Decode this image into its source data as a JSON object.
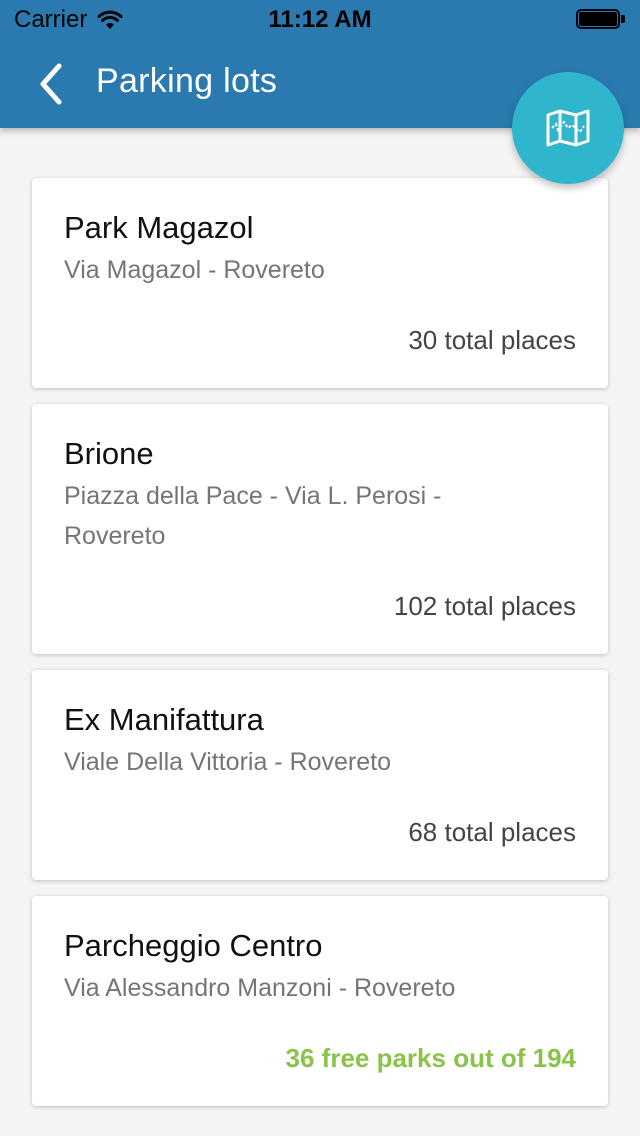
{
  "status_bar": {
    "carrier": "Carrier",
    "time": "11:12 AM"
  },
  "header": {
    "title": "Parking lots",
    "back_icon": "chevron-left-icon",
    "map_icon": "map-icon",
    "background_color": "#2a7ab0",
    "fab_color": "#2fb5cc"
  },
  "parking_lots": [
    {
      "name": "Park Magazol",
      "address": "Via Magazol - Rovereto",
      "places": "30 total places",
      "status": "total"
    },
    {
      "name": "Brione",
      "address": "Piazza della Pace - Via L. Perosi - Rovereto",
      "places": "102 total places",
      "status": "total"
    },
    {
      "name": "Ex Manifattura",
      "address": "Viale Della Vittoria - Rovereto",
      "places": "68 total places",
      "status": "total"
    },
    {
      "name": "Parcheggio Centro",
      "address": "Via Alessandro Manzoni - Rovereto",
      "places": "36 free parks out of 194",
      "status": "free"
    }
  ],
  "colors": {
    "free_places": "#8bc34a"
  }
}
